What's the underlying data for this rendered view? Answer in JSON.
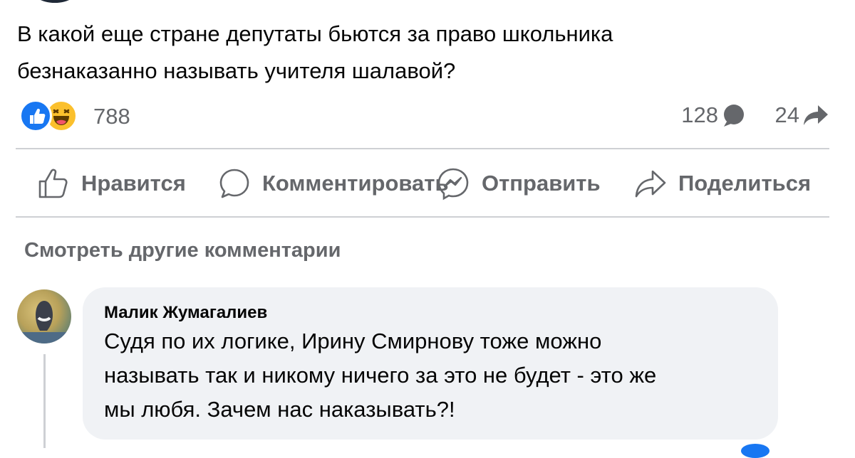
{
  "post": {
    "text_lines": [
      "В какой еще стране депутаты бьются за право школьника",
      "безнаказанно называть учителя шалавой?"
    ]
  },
  "reactions": {
    "icons": [
      "like-icon",
      "haha-icon"
    ],
    "count": "788"
  },
  "stats": {
    "comments": "128",
    "shares": "24"
  },
  "actions": {
    "like": "Нравится",
    "comment": "Комментировать",
    "send": "Отправить",
    "share": "Поделиться"
  },
  "comments_section": {
    "view_more": "Смотреть другие комментарии",
    "comment": {
      "author": "Малик Жумагалиев",
      "lines": [
        "Судя по их логике, Ирину Смирнову тоже можно",
        "называть так и никому ничего за это не будет - это же",
        "мы любя. Зачем нас наказывать?!"
      ]
    }
  },
  "colors": {
    "accent": "#1877f2",
    "secondary_text": "#65676b",
    "divider": "#ced0d4",
    "bubble": "#f0f2f5"
  }
}
